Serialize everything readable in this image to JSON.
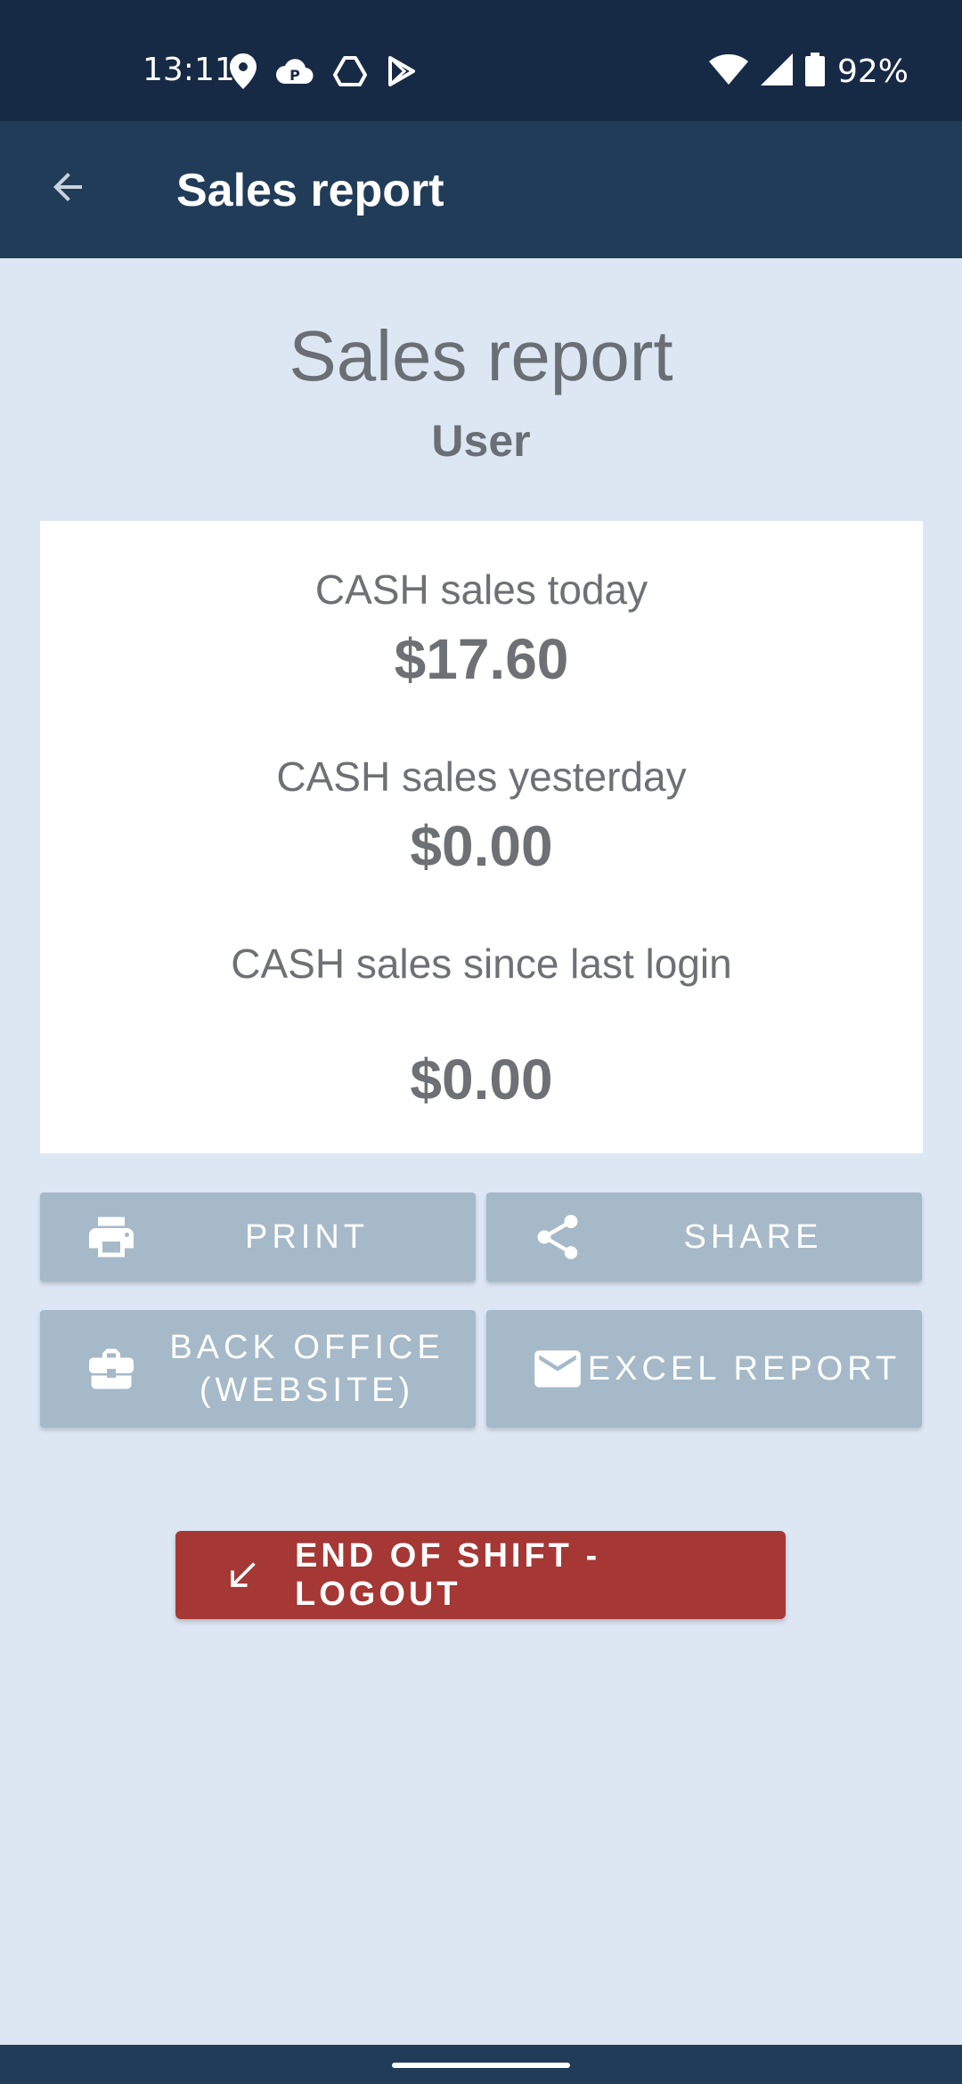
{
  "status_bar": {
    "time": "13:11",
    "battery_percent": "92%",
    "icons_left": [
      "location-icon",
      "parking-cloud-icon",
      "drive-icon",
      "play-store-icon"
    ],
    "icons_right": [
      "wifi-icon",
      "signal-icon",
      "battery-icon"
    ]
  },
  "app_bar": {
    "title": "Sales report",
    "back_icon": "arrow-back-icon"
  },
  "report": {
    "title": "Sales report",
    "user": "User"
  },
  "summary": {
    "today_label": "CASH sales today",
    "today_value": "$17.60",
    "yesterday_label": "CASH sales yesterday",
    "yesterday_value": "$0.00",
    "since_login_label": "CASH sales since last login",
    "since_login_value": "$0.00"
  },
  "actions": {
    "print_label": "PRINT",
    "share_label": "SHARE",
    "back_office_line1": "BACK OFFICE",
    "back_office_line2": "(WEBSITE)",
    "excel_label": "EXCEL REPORT",
    "logout_label": "END OF SHIFT - LOGOUT"
  },
  "colors": {
    "status_bar": "#172a45",
    "app_bar": "#213c58",
    "background": "#dde7f4",
    "secondary_button": "#a5b9c9",
    "logout_button": "#a53735"
  }
}
